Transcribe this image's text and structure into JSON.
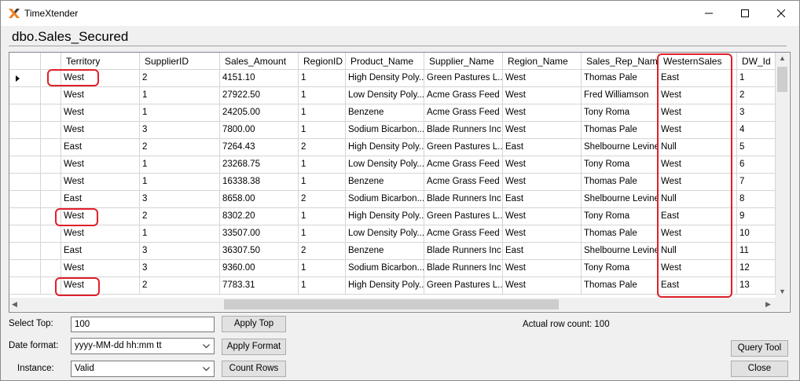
{
  "window": {
    "title": "TimeXtender"
  },
  "heading": "dbo.Sales_Secured",
  "grid": {
    "columns": [
      "Territory",
      "SupplierID",
      "Sales_Amount",
      "RegionID",
      "Product_Name",
      "Supplier_Name",
      "Region_Name",
      "Sales_Rep_Name",
      "WesternSales",
      "DW_Id"
    ],
    "current_row": 0,
    "rows": [
      [
        "West",
        "2",
        "4151.10",
        "1",
        "High Density Poly...",
        "Green Pastures L...",
        "West",
        "Thomas Pale",
        "East",
        "1"
      ],
      [
        "West",
        "1",
        "27922.50",
        "1",
        "Low Density Poly...",
        "Acme Grass Feed",
        "West",
        "Fred Williamson",
        "West",
        "2"
      ],
      [
        "West",
        "1",
        "24205.00",
        "1",
        "Benzene",
        "Acme Grass Feed",
        "West",
        "Tony Roma",
        "West",
        "3"
      ],
      [
        "West",
        "3",
        "7800.00",
        "1",
        "Sodium Bicarbon...",
        "Blade Runners Inc",
        "West",
        "Thomas Pale",
        "West",
        "4"
      ],
      [
        "East",
        "2",
        "7264.43",
        "2",
        "High Density Poly...",
        "Green Pastures L...",
        "East",
        "Shelbourne Levine",
        "Null",
        "5"
      ],
      [
        "West",
        "1",
        "23268.75",
        "1",
        "Low Density Poly...",
        "Acme Grass Feed",
        "West",
        "Tony Roma",
        "West",
        "6"
      ],
      [
        "West",
        "1",
        "16338.38",
        "1",
        "Benzene",
        "Acme Grass Feed",
        "West",
        "Thomas Pale",
        "West",
        "7"
      ],
      [
        "East",
        "3",
        "8658.00",
        "2",
        "Sodium Bicarbon...",
        "Blade Runners Inc",
        "East",
        "Shelbourne Levine",
        "Null",
        "8"
      ],
      [
        "West",
        "2",
        "8302.20",
        "1",
        "High Density Poly...",
        "Green Pastures L...",
        "West",
        "Tony Roma",
        "East",
        "9"
      ],
      [
        "West",
        "1",
        "33507.00",
        "1",
        "Low Density Poly...",
        "Acme Grass Feed",
        "West",
        "Thomas Pale",
        "West",
        "10"
      ],
      [
        "East",
        "3",
        "36307.50",
        "2",
        "Benzene",
        "Blade Runners Inc",
        "East",
        "Shelbourne Levine",
        "Null",
        "11"
      ],
      [
        "West",
        "3",
        "9360.00",
        "1",
        "Sodium Bicarbon...",
        "Blade Runners Inc",
        "West",
        "Tony Roma",
        "West",
        "12"
      ],
      [
        "West",
        "2",
        "7783.31",
        "1",
        "High Density Poly...",
        "Green Pastures L...",
        "West",
        "Thomas Pale",
        "East",
        "13"
      ]
    ]
  },
  "controls": {
    "select_top_label": "Select Top:",
    "select_top_value": "100",
    "apply_top": "Apply Top",
    "date_format_label": "Date format:",
    "date_format_value": "yyyy-MM-dd hh:mm tt",
    "apply_format": "Apply Format",
    "instance_label": "Instance:",
    "instance_value": "Valid",
    "count_rows": "Count Rows",
    "row_count_text": "Actual row count: 100",
    "query_tool": "Query Tool",
    "close": "Close"
  },
  "icons": {
    "app_logo": "timextender-x-logo",
    "minimize": "minimize-icon",
    "maximize": "maximize-icon",
    "close": "close-icon",
    "row_marker": "current-row-arrow-icon",
    "dropdown": "chevron-down-icon"
  },
  "colors": {
    "highlight": "#e0202a",
    "logo_orange": "#f07d1a",
    "logo_dark": "#3a3a3a"
  }
}
